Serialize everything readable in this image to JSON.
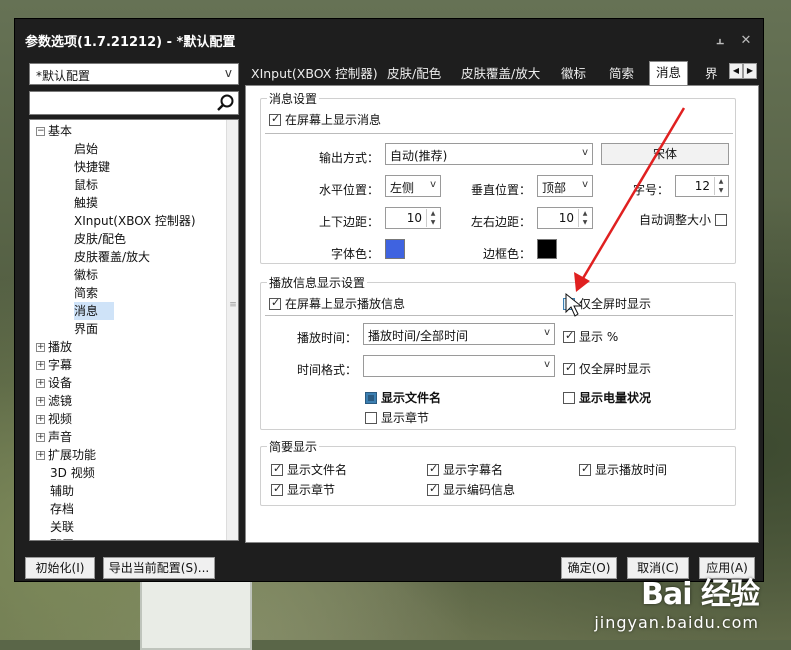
{
  "window": {
    "title": "参数选项(1.7.21212) - *默认配置",
    "pin_icon": "pin-icon",
    "close_icon": "close-icon"
  },
  "profile": {
    "selected": "*默认配置"
  },
  "search": {
    "value": ""
  },
  "tree": [
    {
      "label": "基本",
      "level": 0,
      "expander": "⊟"
    },
    {
      "label": "启始",
      "level": 1
    },
    {
      "label": "快捷键",
      "level": 1
    },
    {
      "label": "鼠标",
      "level": 1
    },
    {
      "label": "触摸",
      "level": 1
    },
    {
      "label": "XInput(XBOX 控制器)",
      "level": 1
    },
    {
      "label": "皮肤/配色",
      "level": 1
    },
    {
      "label": "皮肤覆盖/放大",
      "level": 1
    },
    {
      "label": "徽标",
      "level": 1
    },
    {
      "label": "简索",
      "level": 1
    },
    {
      "label": "消息",
      "level": 1,
      "selected": true
    },
    {
      "label": "界面",
      "level": 1
    },
    {
      "label": "播放",
      "level": 0,
      "expander": "⊞"
    },
    {
      "label": "字幕",
      "level": 0,
      "expander": "⊞"
    },
    {
      "label": "设备",
      "level": 0,
      "expander": "⊞"
    },
    {
      "label": "滤镜",
      "level": 0,
      "expander": "⊞"
    },
    {
      "label": "视频",
      "level": 0,
      "expander": "⊞"
    },
    {
      "label": "声音",
      "level": 0,
      "expander": "⊞"
    },
    {
      "label": "扩展功能",
      "level": 0,
      "expander": "⊞"
    },
    {
      "label": "3D 视频",
      "level": 0
    },
    {
      "label": "辅助",
      "level": 0
    },
    {
      "label": "存档",
      "level": 0
    },
    {
      "label": "关联",
      "level": 0
    },
    {
      "label": "配置",
      "level": 0
    }
  ],
  "tabs": [
    "XInput(XBOX 控制器)",
    "皮肤/配色",
    "皮肤覆盖/放大",
    "徽标",
    "简索",
    "消息",
    "界"
  ],
  "active_tab": "消息",
  "msg": {
    "group_title": "消息设置",
    "show_on_screen": "在屏幕上显示消息",
    "output_label": "输出方式：",
    "output_value": "自动(推荐)",
    "font_button": "宋体",
    "hpos_label": "水平位置：",
    "hpos_value": "左侧",
    "vpos_label": "垂直位置：",
    "vpos_value": "顶部",
    "size_label": "字号：",
    "size_value": "12",
    "tb_margin_label": "上下边距：",
    "tb_margin_value": "10",
    "lr_margin_label": "左右边距：",
    "lr_margin_value": "10",
    "autosize_label": "自动调整大小",
    "font_color_label": "字体色：",
    "border_color_label": "边框色：",
    "font_color": "#3f63e0",
    "border_color": "#000000"
  },
  "play": {
    "group_title": "播放信息显示设置",
    "show_on_screen": "在屏幕上显示播放信息",
    "fullscreen_only": "仅全屏时显示",
    "time_label": "播放时间：",
    "time_value": "播放时间/全部时间",
    "show_percent": "显示 %",
    "format_label": "时间格式：",
    "format_value": "",
    "fullscreen_only2": "仅全屏时显示",
    "show_filename": "显示文件名",
    "show_battery": "显示电量状况",
    "show_chapter": "显示章节"
  },
  "brief": {
    "group_title": "简要显示",
    "items": [
      "显示文件名",
      "显示字幕名",
      "显示播放时间",
      "显示章节",
      "显示编码信息"
    ]
  },
  "bottom": {
    "init": "初始化(I)",
    "export": "导出当前配置(S)...",
    "ok": "确定(O)",
    "cancel": "取消(C)",
    "apply": "应用(A)"
  },
  "watermark": {
    "logo": "Bai 经验",
    "url": "jingyan.baidu.com"
  },
  "colors": {
    "accent_arrow": "#e02020",
    "selection": "#cfe3f8"
  }
}
